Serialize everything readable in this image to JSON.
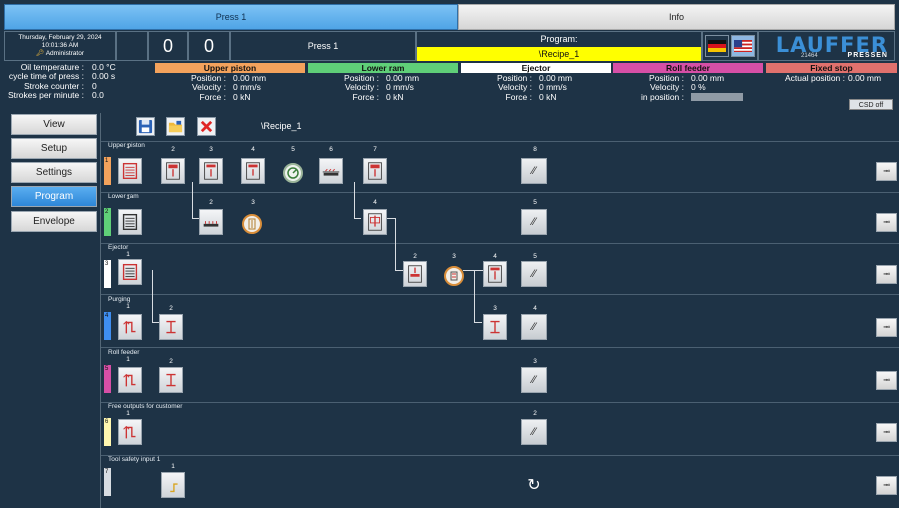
{
  "tabs": {
    "press": "Press 1",
    "info": "Info"
  },
  "header": {
    "date": "Thursday, February 29, 2024",
    "time": "10:01:36 AM",
    "user": "Administrator",
    "counter1": "0",
    "counter2": "0",
    "press_name": "Press 1",
    "program_label": "Program:",
    "program_value": "\\Recipe_1",
    "logo_main": "LAUFFER",
    "logo_sub": "PRESSEN",
    "logo_code": "21464"
  },
  "status": {
    "oil_label": "Oil temperature :",
    "oil_value": "0.0 °C",
    "cycle_label": "cycle time of press :",
    "cycle_value": "0.00 s",
    "stroke_label": "Stroke counter :",
    "stroke_value": "0",
    "spm_label": "Strokes per minute :",
    "spm_value": "0.0"
  },
  "groups": {
    "upper": {
      "title": "Upper piston",
      "color": "#f3a25c",
      "k1": "Position :",
      "v1": "0.00 mm",
      "k2": "Velocity :",
      "v2": "0 mm/s",
      "k3": "Force :",
      "v3": "0 kN"
    },
    "lower": {
      "title": "Lower ram",
      "color": "#5fcf78",
      "k1": "Position :",
      "v1": "0.00 mm",
      "k2": "Velocity :",
      "v2": "0 mm/s",
      "k3": "Force :",
      "v3": "0 kN"
    },
    "ejector": {
      "title": "Ejector",
      "color": "#ffffff",
      "k1": "Position :",
      "v1": "0.00 mm",
      "k2": "Velocity :",
      "v2": "0 mm/s",
      "k3": "Force :",
      "v3": "0 kN"
    },
    "roll": {
      "title": "Roll feeder",
      "color": "#d64fa6",
      "k1": "Position :",
      "v1": "0.00 mm",
      "k2": "Velocity :",
      "v2": "0 %",
      "k3": "in position :"
    },
    "fixed": {
      "title": "Fixed stop",
      "color": "#e0716d",
      "k1": "Actual position :",
      "v1": "0.00 mm",
      "csd": "CSD off"
    }
  },
  "nav": [
    "View",
    "Setup",
    "Settings",
    "Program",
    "Envelope"
  ],
  "recipe": "\\Recipe_1",
  "lanes": [
    {
      "title": "Upper piston",
      "num": "1",
      "color": "#f3a25c"
    },
    {
      "title": "Lower ram",
      "num": "2",
      "color": "#5fcf78"
    },
    {
      "title": "Ejector",
      "num": "3",
      "color": "#ffffff"
    },
    {
      "title": "Purging",
      "num": "4",
      "color": "#3e8ef0"
    },
    {
      "title": "Roll feeder",
      "num": "5",
      "color": "#d64fa6"
    },
    {
      "title": "Free outputs for customer",
      "num": "6",
      "color": "#fff7b0"
    },
    {
      "title": "Tool safety input 1",
      "num": "7",
      "color": "#d8dde2"
    }
  ],
  "steps": {
    "l1": [
      "1",
      "2",
      "3",
      "4",
      "5",
      "6",
      "7",
      "8"
    ],
    "l2": [
      "1",
      "2",
      "3",
      "4",
      "5"
    ],
    "l3": [
      "1",
      "2",
      "3",
      "4",
      "5"
    ],
    "l4": [
      "1",
      "2",
      "3",
      "4"
    ],
    "l5": [
      "1",
      "2",
      "3"
    ],
    "l6": [
      "1",
      "2"
    ],
    "l7": [
      "1"
    ]
  }
}
